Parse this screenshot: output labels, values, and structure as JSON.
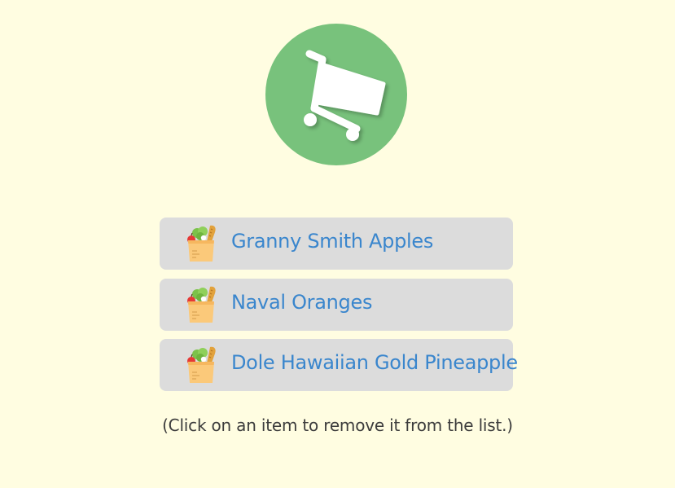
{
  "header": {
    "logo_icon": "shopping-cart-icon",
    "logo_color": "#78c27c"
  },
  "grocery_list": {
    "item_icon": "grocery-bag-icon",
    "label_color": "#3a86cd",
    "items": [
      {
        "label": "Granny Smith Apples"
      },
      {
        "label": "Naval Oranges"
      },
      {
        "label": "Dole Hawaiian Gold Pineapple"
      }
    ]
  },
  "hint": "(Click on an item to remove it from the list.)",
  "colors": {
    "background": "#fffde1",
    "item_background": "#dcdcdc",
    "hint_text": "#3c3c3c"
  }
}
